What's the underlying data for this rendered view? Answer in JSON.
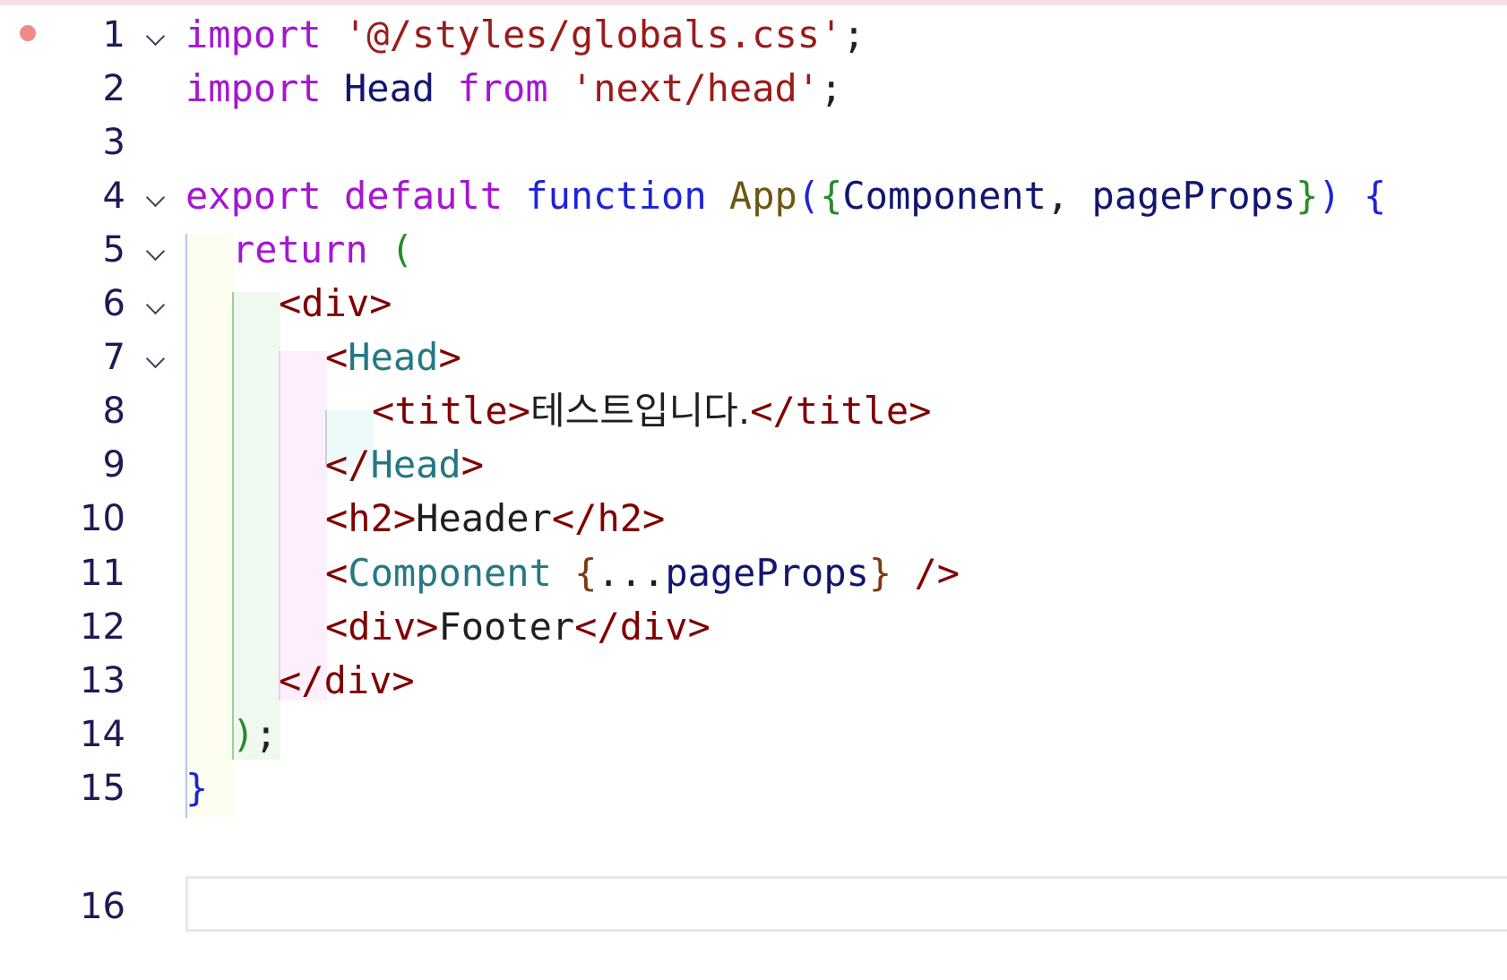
{
  "editor": {
    "breakpoint_line": 1,
    "current_line": 16,
    "foldable_lines": [
      1,
      4,
      5,
      6,
      7
    ]
  },
  "line_numbers": [
    "1",
    "2",
    "3",
    "4",
    "5",
    "6",
    "7",
    "8",
    "9",
    "10",
    "11",
    "12",
    "13",
    "14",
    "15",
    "16"
  ],
  "code": {
    "l1": {
      "kw": "import",
      "sp": " ",
      "str": "'@/styles/globals.css'",
      "semi": ";"
    },
    "l2": {
      "kw": "import",
      "sp1": " ",
      "ident": "Head",
      "sp2": " ",
      "kw2": "from",
      "sp3": " ",
      "str": "'next/head'",
      "semi": ";"
    },
    "l3": {},
    "l4": {
      "kw1": "export",
      "sp1": " ",
      "kw2": "default",
      "sp2": " ",
      "kw3": "function",
      "sp3": " ",
      "fn": "App",
      "p1": "(",
      "b1": "{",
      "a1": "Component",
      "comma": ", ",
      "a2": "pageProps",
      "b2": "}",
      "p2": ")",
      "sp4": " ",
      "b3": "{"
    },
    "l5": {
      "kw": "return",
      "sp": " ",
      "p": "("
    },
    "l6": {
      "tag": "<div>"
    },
    "l7": {
      "lt": "<",
      "comp": "Head",
      "gt": ">"
    },
    "l8": {
      "open": "<title>",
      "text": "테스트입니다.",
      "close": "</title>"
    },
    "l9": {
      "lt": "</",
      "comp": "Head",
      "gt": ">"
    },
    "l10": {
      "open": "<h2>",
      "text": "Header",
      "close": "</h2>"
    },
    "l11": {
      "lt": "<",
      "comp": "Component",
      "sp": " ",
      "b1": "{",
      "spread": "...",
      "ident": "pageProps",
      "b2": "}",
      "end": " />"
    },
    "l12": {
      "open": "<div>",
      "text": "Footer",
      "close": "</div>"
    },
    "l13": {
      "tag": "</div>"
    },
    "l14": {
      "p": ")",
      "semi": ";"
    },
    "l15": {
      "b": "}"
    },
    "l16": {}
  },
  "colors": {
    "keyword": "#a615d1",
    "declaration": "#1f23d6",
    "string": "#9b1b1b",
    "identifier": "#12166f",
    "function": "#6e5614",
    "tag": "#800000",
    "component": "#247884",
    "breakpoint": "#f08a85"
  },
  "icons": {
    "fold": "chevron-down-icon",
    "breakpoint": "breakpoint-dot-icon"
  }
}
